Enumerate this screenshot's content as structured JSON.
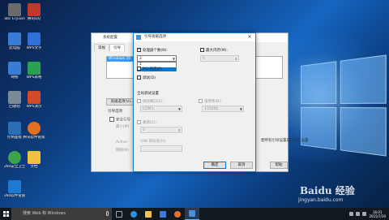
{
  "desktop": {
    "icons": [
      {
        "label": "abc Eryuan",
        "color": "#6b6b6b"
      },
      {
        "label": "腾讯QQ",
        "color": "#c0392b"
      },
      {
        "label": "此电脑",
        "color": "#3a7bd5"
      },
      {
        "label": "WPS文字",
        "color": "#2f6fd6"
      },
      {
        "label": "网络",
        "color": "#3a7bd5"
      },
      {
        "label": "WPS表格",
        "color": "#2aa052"
      },
      {
        "label": "回收站",
        "color": "#7a8a99"
      },
      {
        "label": "WPS演示",
        "color": "#d04a2b"
      },
      {
        "label": "控制面板",
        "color": "#2a6fb5"
      },
      {
        "label": "腾讯软件管家",
        "color": "#e07020"
      },
      {
        "label": "360安全卫士",
        "color": "#3fa34d"
      },
      {
        "label": "文档",
        "color": "#f0c040"
      },
      {
        "label": "360软件管家",
        "color": "#1e7ad0"
      }
    ]
  },
  "system_config": {
    "title": "系统配置",
    "tabs": [
      "常规",
      "引导"
    ],
    "os_entry": "Windows 10 (C:\\Windows)",
    "advanced_button": "高级选项(V)...",
    "boot_options_label": "引导选项",
    "safe_boot": "安全引导",
    "minimal": "最小(M)",
    "active": "Active",
    "network": "网络(N)",
    "help_button": "帮助",
    "permanent": "使所有引导设置成为永久设置"
  },
  "dialog": {
    "title": "引导高级选项",
    "close_glyph": "✕",
    "cpu_label": "处理器个数(N):",
    "cpu_checked": true,
    "cpu_value": "2",
    "cpu_options": [
      "1",
      "2"
    ],
    "cpu_selected_index": 1,
    "memory_label": "最大内存(M):",
    "memory_value": "0",
    "pci_lock": "PCI 锁定(P)",
    "debug": "调试(D)",
    "global_debug": "全局调试设置",
    "debug_port_label": "调试端口(E):",
    "debug_port_value": "COM1:",
    "baud_label": "波特率(B):",
    "baud_value": "115200",
    "channel_label": "通道(C):",
    "channel_value": "0",
    "usb_label": "USB 目标名(U):",
    "usb_value": "",
    "ok": "确定",
    "cancel": "取消"
  },
  "taskbar": {
    "search_placeholder": "搜索 Web 和 Windows",
    "apps": [
      {
        "name": "task-view",
        "color": "#9aa4b0"
      },
      {
        "name": "edge",
        "color": "#2f8fe0"
      },
      {
        "name": "file-explorer",
        "color": "#f2c14e"
      },
      {
        "name": "store",
        "color": "#3a7bd5"
      },
      {
        "name": "firefox",
        "color": "#e8702a"
      },
      {
        "name": "system-config",
        "color": "#4a90d9"
      }
    ],
    "time": "16:01",
    "date": "2015/7/30"
  },
  "watermark": {
    "text": "Baidu 经验",
    "url": "jingyan.baidu.com"
  }
}
